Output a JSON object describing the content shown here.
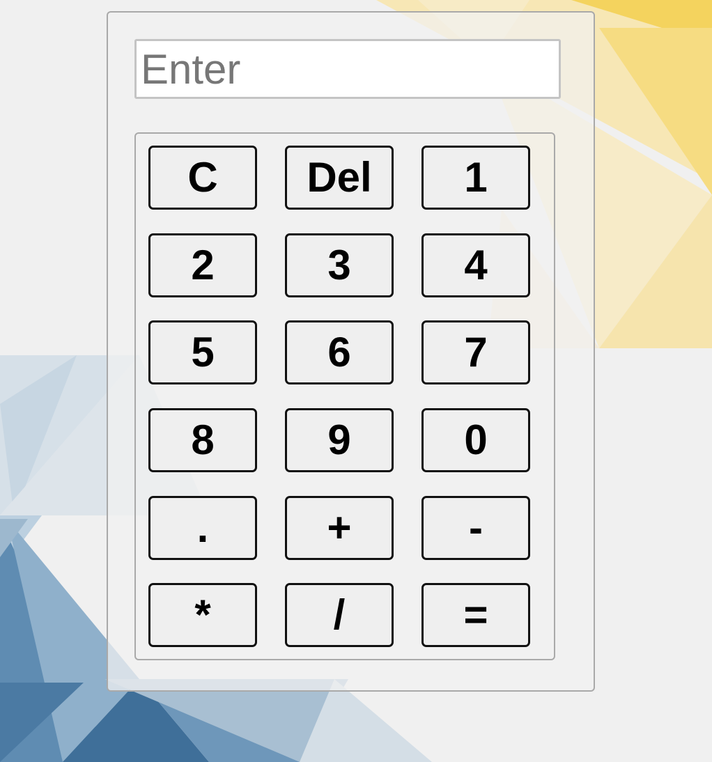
{
  "display": {
    "placeholder": "Enter",
    "value": ""
  },
  "keys": [
    "C",
    "Del",
    "1",
    "2",
    "3",
    "4",
    "5",
    "6",
    "7",
    "8",
    "9",
    "0",
    ".",
    "+",
    "-",
    "*",
    "/",
    "="
  ],
  "colors": {
    "page_background": "#f0f0f0",
    "key_background": "#efefef",
    "key_border": "#111111",
    "panel_border": "#a9a9a9",
    "placeholder": "#777777",
    "accent_yellow": "#f6d35a",
    "accent_blue": "#3f6f99"
  }
}
